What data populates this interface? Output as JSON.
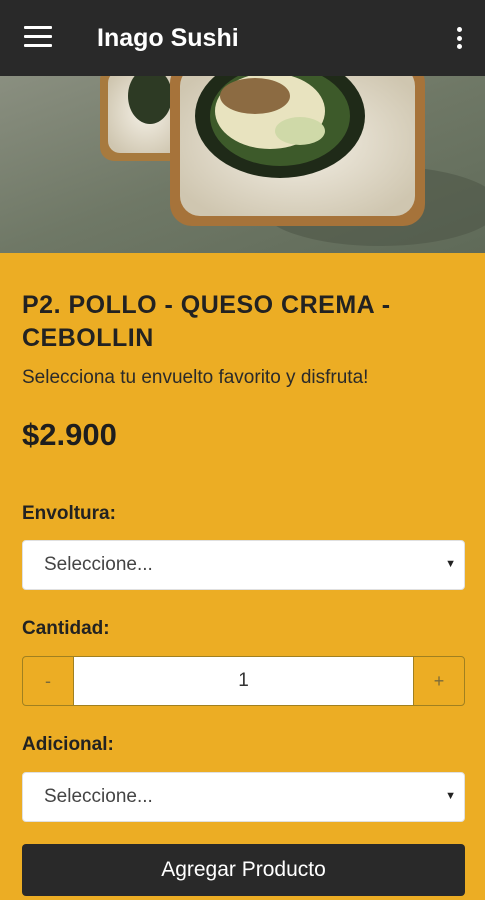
{
  "appbar": {
    "title": "Inago Sushi",
    "menu_icon": "hamburger-menu-icon",
    "more_icon": "more-vertical-icon"
  },
  "hero": {
    "alt": "Sushi roll photo"
  },
  "product": {
    "title": "P2. POLLO - QUESO CREMA - CEBOLLIN",
    "description": "Selecciona tu envuelto favorito y disfruta!",
    "price": "$2.900"
  },
  "form": {
    "envoltura_label": "Envoltura:",
    "envoltura_value": "Seleccione...",
    "cantidad_label": "Cantidad:",
    "cantidad_minus": "-",
    "cantidad_value": "1",
    "cantidad_plus": "+",
    "adicional_label": "Adicional:",
    "adicional_value": "Seleccione...",
    "add_button": "Agregar Producto"
  },
  "colors": {
    "appbar": "#292929",
    "background": "#ECAD24",
    "button": "#292929"
  }
}
